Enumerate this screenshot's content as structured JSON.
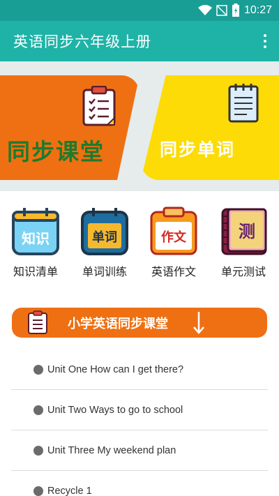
{
  "status_bar": {
    "time": "10:27"
  },
  "app_bar": {
    "title": "英语同步六年级上册",
    "menu_icon": "more-vert-icon"
  },
  "banner": {
    "left_card": {
      "label": "同步课堂",
      "icon": "clipboard-checklist-icon",
      "color": "#ef7012"
    },
    "right_card": {
      "label": "同步单词",
      "icon": "notepad-icon",
      "color": "#fddb06"
    }
  },
  "categories": [
    {
      "tile_text": "知识",
      "label": "知识清单",
      "icon": "calendar-tile-icon"
    },
    {
      "tile_text": "单词",
      "label": "单词训练",
      "icon": "calendar-tile-icon"
    },
    {
      "tile_text": "作文",
      "label": "英语作文",
      "icon": "notebook-tile-icon"
    },
    {
      "tile_text": "测",
      "label": "单元测试",
      "icon": "book-tile-icon"
    }
  ],
  "section": {
    "title": "小学英语同步课堂",
    "icon": "clipboard-icon",
    "arrow_icon": "arrow-down-icon"
  },
  "units": [
    {
      "label": "Unit One How can I get there?"
    },
    {
      "label": "Unit Two Ways to go to school"
    },
    {
      "label": "Unit Three My weekend plan"
    },
    {
      "label": "Recycle 1"
    }
  ],
  "colors": {
    "primary": "#1fb3a8",
    "status": "#189e95",
    "accent_orange": "#ef7012",
    "accent_yellow": "#fddb06"
  }
}
